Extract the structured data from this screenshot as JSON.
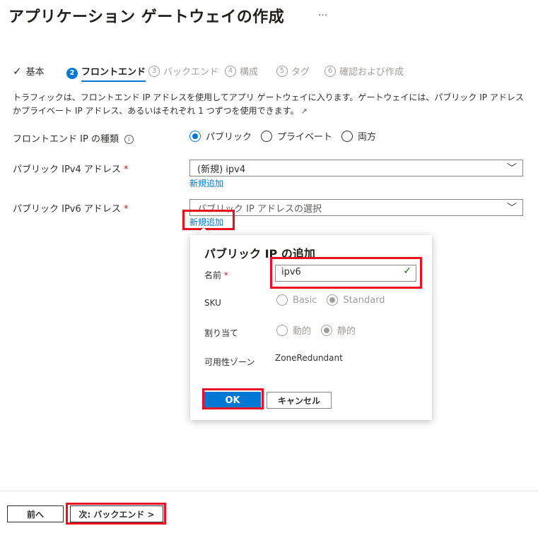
{
  "page": {
    "title": "アプリケーション ゲートウェイの作成",
    "more": "···"
  },
  "tabs": [
    {
      "label": "基本",
      "state": "done",
      "icon": "checkmark-icon"
    },
    {
      "number": "2",
      "label": "フロントエンド",
      "state": "active"
    },
    {
      "number": "3",
      "label": "バックエンド",
      "state": "disabled"
    },
    {
      "number": "4",
      "label": "構成",
      "state": "disabled"
    },
    {
      "number": "5",
      "label": "タグ",
      "state": "disabled"
    },
    {
      "number": "6",
      "label": "確認および作成",
      "state": "disabled"
    }
  ],
  "description": "トラフィックは、フロントエンド IP アドレスを使用してアプリ ゲートウェイに入ります。ゲートウェイには、パブリック IP アドレスかプライベート IP アドレス、あるいはそれぞれ 1 つずつを使用できます。",
  "form": {
    "frontend_ip_type": {
      "label": "フロントエンド IP の種類",
      "info_icon": "i",
      "options": [
        "パブリック",
        "プライベート",
        "両方"
      ],
      "selected": "パブリック"
    },
    "ipv4": {
      "label": "パブリック IPv4 アドレス",
      "required": "*",
      "value": "(新規) ipv4",
      "add_link": "新規追加"
    },
    "ipv6": {
      "label": "パブリック IPv6 アドレス",
      "required": "*",
      "placeholder": "パブリック IP アドレスの選択",
      "add_link": "新規追加"
    }
  },
  "panel": {
    "title": "パブリック IP の追加",
    "name_label": "名前",
    "name_required": "*",
    "name_value": "ipv6",
    "sku_label": "SKU",
    "sku_options": [
      "Basic",
      "Standard"
    ],
    "sku_selected": "Standard",
    "assign_label": "割り当て",
    "assign_options": [
      "動的",
      "静的"
    ],
    "assign_selected": "静的",
    "zone_label": "可用性ゾーン",
    "zone_value": "ZoneRedundant",
    "ok": "OK",
    "cancel": "キャンセル"
  },
  "footer": {
    "prev": "前へ",
    "next": "次: バックエンド >"
  },
  "colors": {
    "accent": "#0078d4",
    "highlight": "#e81123",
    "valid": "#107c10"
  }
}
